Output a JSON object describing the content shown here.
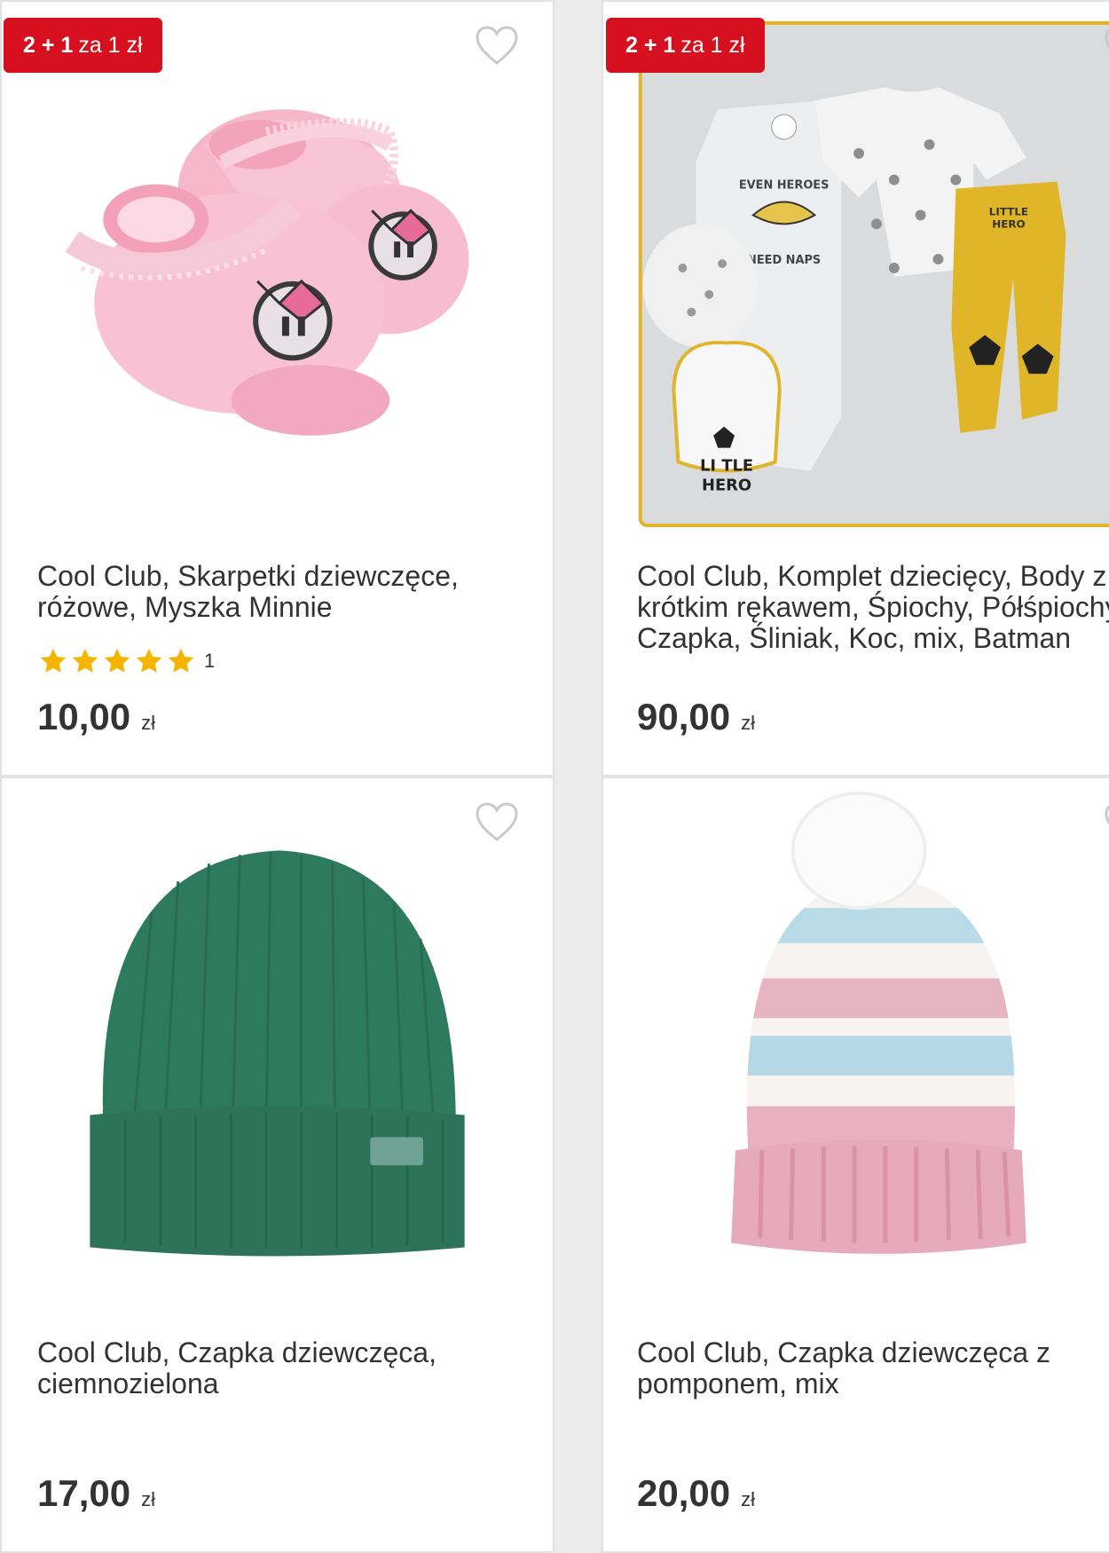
{
  "accent_color": "#d6101e",
  "star_color": "#f5b400",
  "products": [
    {
      "badge_bold": "2 + 1",
      "badge_rest": "za 1 zł",
      "title": "Cool Club, Skarpetki dziewczęce, różowe, Myszka Minnie",
      "rating_stars": 5,
      "rating_count": "1",
      "price": "10,00",
      "currency": "zł",
      "image_icon": "baby-socks-image"
    },
    {
      "badge_bold": "2 + 1",
      "badge_rest": "za 1 zł",
      "title": "Cool Club, Komplet dziecięcy, Body z krótkim rękawem, Śpiochy, Półśpiochy, Czapka, Śliniak, Koc, mix, Batman",
      "image_text_top": "EVEN HEROES",
      "image_text_bottom": "NEED NAPS",
      "image_text_bib1": "LI TLE",
      "image_text_bib2": "HERO",
      "image_text_pants1": "LITTLE",
      "image_text_pants2": "HERO",
      "price": "90,00",
      "currency": "zł",
      "image_icon": "baby-set-image"
    },
    {
      "title": "Cool Club, Czapka dziewczęca, ciemnozielona",
      "price": "17,00",
      "currency": "zł",
      "image_icon": "green-beanie-image"
    },
    {
      "title": "Cool Club, Czapka dziewczęca z pomponem, mix",
      "price": "20,00",
      "currency": "zł",
      "image_icon": "pompom-hat-image"
    }
  ]
}
